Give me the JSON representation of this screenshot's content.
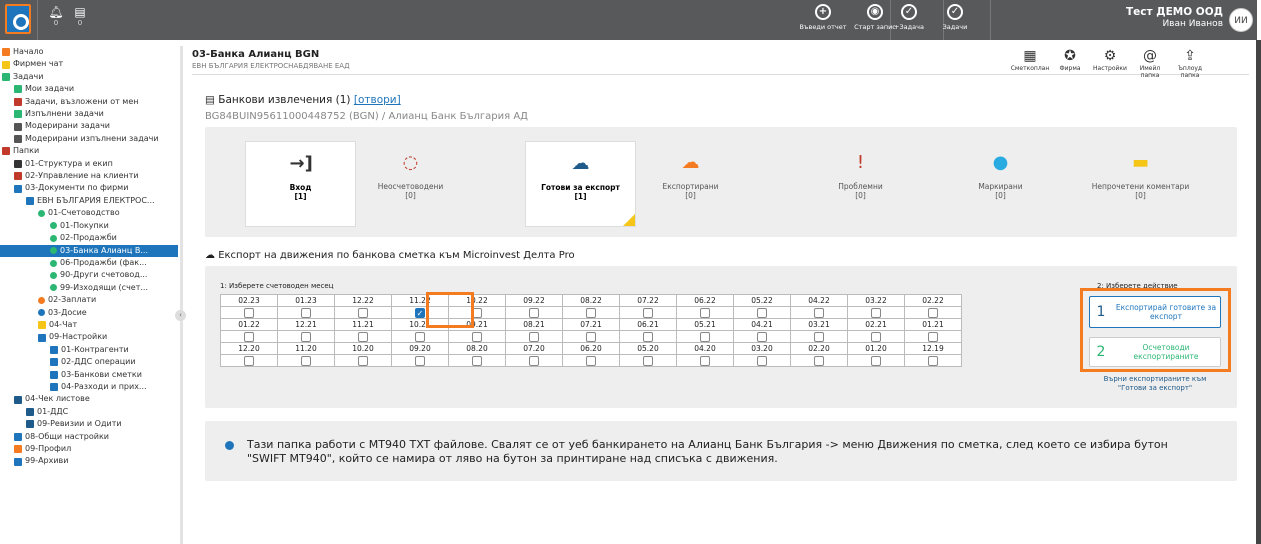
{
  "topbar": {
    "notifications_count": "0",
    "messages_count": "0",
    "actions": [
      {
        "label": "Въведи отчет",
        "icon": "plus-circle-icon"
      },
      {
        "label": "Старт запис",
        "icon": "record-icon"
      },
      {
        "label": "+Задача",
        "icon": "add-task-icon"
      },
      {
        "label": "Задачи",
        "icon": "tasks-icon"
      }
    ],
    "company": "Тест ДЕМО ООД",
    "user": "Иван Иванов",
    "avatar": "ИИ"
  },
  "sidebar": {
    "items": [
      {
        "label": "Начало",
        "indent": 0,
        "icon": "home-icon",
        "color": "#f47b20"
      },
      {
        "label": "Фирмен чат",
        "indent": 0,
        "icon": "chat-icon",
        "color": "#f5c518"
      },
      {
        "label": "Задачи",
        "indent": 0,
        "icon": "check-circle-icon",
        "color": "#2bb673"
      },
      {
        "label": "Мои задачи",
        "indent": 1,
        "icon": "clock-icon",
        "color": "#2bb673"
      },
      {
        "label": "Задачи, възложени от мен",
        "indent": 1,
        "icon": "list-icon",
        "color": "#c0392b"
      },
      {
        "label": "Изпълнени задачи",
        "indent": 1,
        "icon": "check-icon",
        "color": "#2bb673"
      },
      {
        "label": "Модерирани задачи",
        "indent": 1,
        "icon": "check-circle-icon",
        "color": "#555"
      },
      {
        "label": "Модерирани изпълнени задачи",
        "indent": 1,
        "icon": "check-circle-icon",
        "color": "#555"
      },
      {
        "label": "Папки",
        "indent": 0,
        "icon": "globe-icon",
        "color": "#c0392b"
      },
      {
        "label": "01-Структура и екип",
        "indent": 1,
        "icon": "people-icon",
        "color": "#333"
      },
      {
        "label": "02-Управление на клиенти",
        "indent": 1,
        "icon": "target-icon",
        "color": "#c0392b"
      },
      {
        "label": "03-Документи по фирми",
        "indent": 1,
        "icon": "folder-icon",
        "color": "#1e75bb"
      },
      {
        "label": "ЕВН БЪЛГАРИЯ ЕЛЕКТРОС...",
        "indent": 2,
        "icon": "folder-icon",
        "color": "#1e75bb"
      },
      {
        "label": "01-Счетоводство",
        "indent": 3,
        "icon": "dot-icon",
        "color": "#2bb673"
      },
      {
        "label": "01-Покупки",
        "indent": 4,
        "icon": "dot-icon",
        "color": "#2bb673"
      },
      {
        "label": "02-Продажби",
        "indent": 4,
        "icon": "dot-icon",
        "color": "#2bb673"
      },
      {
        "label": "03-Банка Алианц В...",
        "indent": 4,
        "icon": "dot-icon",
        "color": "#2bb673",
        "selected": true
      },
      {
        "label": "06-Продажби (фак...",
        "indent": 4,
        "icon": "dot-icon",
        "color": "#2bb673"
      },
      {
        "label": "90-Други счетовод...",
        "indent": 4,
        "icon": "dot-icon",
        "color": "#2bb673"
      },
      {
        "label": "99-Изходящи (счет...",
        "indent": 4,
        "icon": "dot-icon",
        "color": "#2bb673"
      },
      {
        "label": "02-Заплати",
        "indent": 3,
        "icon": "dot-icon",
        "color": "#f47b20"
      },
      {
        "label": "03-Досие",
        "indent": 3,
        "icon": "dot-icon",
        "color": "#1e75bb"
      },
      {
        "label": "04-Чат",
        "indent": 3,
        "icon": "chat-icon",
        "color": "#f5c518"
      },
      {
        "label": "09-Настройки",
        "indent": 3,
        "icon": "gear-icon",
        "color": "#1e75bb"
      },
      {
        "label": "01-Контрагенти",
        "indent": 4,
        "icon": "gear-icon",
        "color": "#1e75bb"
      },
      {
        "label": "02-ДДС операции",
        "indent": 4,
        "icon": "gear-icon",
        "color": "#1e75bb"
      },
      {
        "label": "03-Банкови сметки",
        "indent": 4,
        "icon": "gear-icon",
        "color": "#1e75bb"
      },
      {
        "label": "04-Разходи и прих...",
        "indent": 4,
        "icon": "gear-icon",
        "color": "#1e75bb"
      },
      {
        "label": "04-Чек листове",
        "indent": 1,
        "icon": "check-circle-icon",
        "color": "#1e5a8a"
      },
      {
        "label": "01-ДДС",
        "indent": 2,
        "icon": "check-circle-icon",
        "color": "#1e5a8a"
      },
      {
        "label": "09-Ревизии и Одити",
        "indent": 2,
        "icon": "check-circle-icon",
        "color": "#1e5a8a"
      },
      {
        "label": "08-Общи настройки",
        "indent": 1,
        "icon": "gear-icon",
        "color": "#1e75bb"
      },
      {
        "label": "09-Профил",
        "indent": 1,
        "icon": "check-circle-icon",
        "color": "#f47b20"
      },
      {
        "label": "99-Архиви",
        "indent": 1,
        "icon": "archive-icon",
        "color": "#1e75bb"
      }
    ]
  },
  "page": {
    "title": "03-Банка Алианц BGN",
    "subtitle": "ЕВН БЪЛГАРИЯ ЕЛЕКТРОСНАБДЯВАНЕ ЕАД"
  },
  "tools": [
    {
      "label": "Сметкоплан",
      "icon": "chart-of-accounts-icon"
    },
    {
      "label": "Фирма",
      "icon": "company-icon"
    },
    {
      "label": "Настройки",
      "icon": "gear-icon"
    },
    {
      "label": "Имейл папка",
      "icon": "email-icon"
    },
    {
      "label": "Ъплоуд папка",
      "icon": "upload-icon"
    }
  ],
  "statement": {
    "prefix": "Банкови извлечения (1)",
    "link": "[отвори]",
    "iban": "BG84BUIN95611000448752 (BGN) / Алианц Банк България АД"
  },
  "cards": [
    {
      "title": "Вход",
      "count": "[1]",
      "icon": "login-icon",
      "color": "#333",
      "active": true
    },
    {
      "title": "Неосчетоводени",
      "count": "[0]",
      "icon": "progress-icon",
      "color": "#c0392b",
      "active": false
    },
    {
      "title": "Готови за експорт",
      "count": "[1]",
      "icon": "cloud-download-icon",
      "color": "#1e5a8a",
      "active": true
    },
    {
      "title": "Експортирани",
      "count": "[0]",
      "icon": "cloud-check-icon",
      "color": "#f47b20",
      "active": false
    },
    {
      "title": "Проблемни",
      "count": "[0]",
      "icon": "alert-icon",
      "color": "#c0392b",
      "active": false
    },
    {
      "title": "Маркирани",
      "count": "[0]",
      "icon": "marked-icon",
      "color": "#29abe2",
      "active": false
    },
    {
      "title": "Непрочетени коментари",
      "count": "[0]",
      "icon": "comment-icon",
      "color": "#f5c518",
      "active": false
    }
  ],
  "export": {
    "heading": "Експорт на движения по банкова сметка към Microinvest Делта Pro",
    "step1": "1: Изберете счетоводен месец",
    "step2": "2: Изберете действие",
    "months": [
      [
        "02.23",
        "01.23",
        "12.22",
        "11.22",
        "10.22",
        "09.22",
        "08.22",
        "07.22",
        "06.22",
        "05.22",
        "04.22",
        "03.22",
        "02.22"
      ],
      [
        "01.22",
        "12.21",
        "11.21",
        "10.21",
        "09.21",
        "08.21",
        "07.21",
        "06.21",
        "05.21",
        "04.21",
        "03.21",
        "02.21",
        "01.21"
      ],
      [
        "12.20",
        "11.20",
        "10.20",
        "09.20",
        "08.20",
        "07.20",
        "06.20",
        "05.20",
        "04.20",
        "03.20",
        "02.20",
        "01.20",
        "12.19"
      ]
    ],
    "checked": "11.22",
    "actions": [
      {
        "num": "1",
        "label": "Експортирай готовите за експорт"
      },
      {
        "num": "2",
        "label": "Осчетоводи експортираните"
      }
    ],
    "return_label": "Върни експортираните към \"Готови за експорт\""
  },
  "info": "Тази папка работи с MT940 TXT файлове. Свалят се от уеб банкирането на Алианц Банк България -> меню Движения по сметка, след което се избира бутон \"SWIFT MT940\", който се намира от ляво на бутон за принтиране над списъка с движения."
}
